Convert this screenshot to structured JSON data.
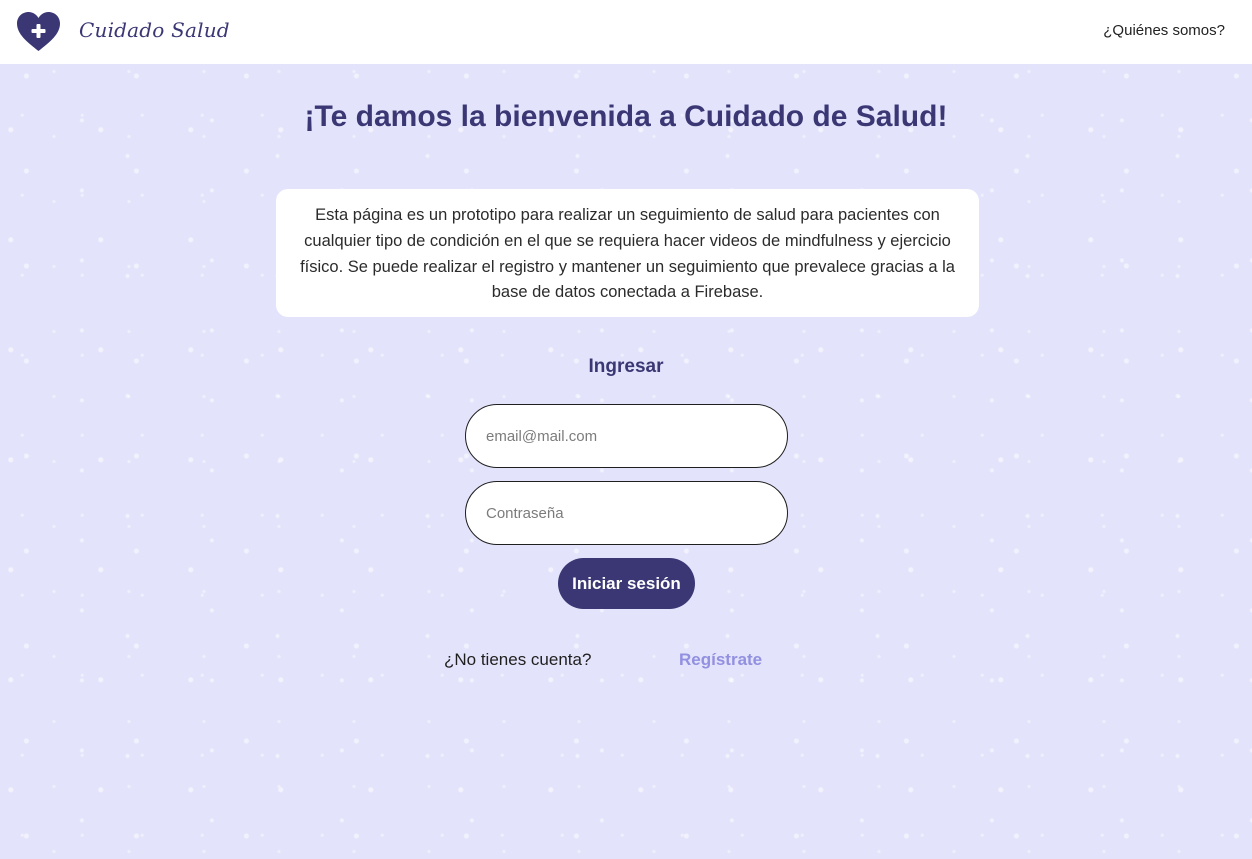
{
  "header": {
    "brand": "Cuidado Salud",
    "logo_icon": "heart-plus-icon",
    "nav_link": "¿Quiénes somos?"
  },
  "main": {
    "title": "¡Te damos la bienvenida a Cuidado de Salud!",
    "description": "Esta página es un prototipo para realizar un seguimiento de salud para pacientes con cualquier tipo de condición en el que se requiera hacer videos de mindfulness y ejercicio físico. Se puede realizar el registro y mantener un seguimiento que prevalece gracias a la base de datos conectada a Firebase."
  },
  "login": {
    "heading": "Ingresar",
    "email_placeholder": "email@mail.com",
    "password_placeholder": "Contraseña",
    "submit_label": "Iniciar sesión",
    "no_account_text": "¿No tienes cuenta?",
    "register_label": "Regístrate"
  },
  "colors": {
    "primary": "#3a3774",
    "accent": "#9290e0",
    "background": "#e3e4fb",
    "surface": "#ffffff"
  }
}
